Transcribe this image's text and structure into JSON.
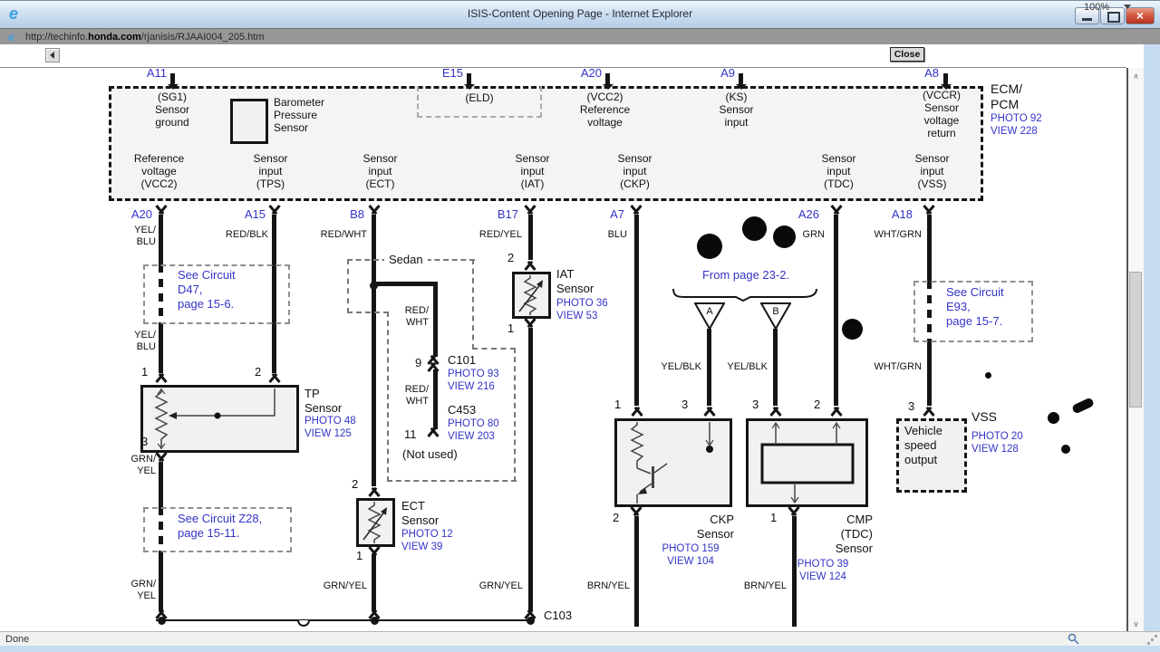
{
  "titlebar": {
    "title": "ISIS-Content Opening Page - Internet Explorer"
  },
  "addressbar": {
    "url_pre": "http://techinfo.",
    "url_domain": "honda.com",
    "url_path": "/rjanisis/RJAAI004_205.htm"
  },
  "toolbar": {
    "close": "Close"
  },
  "statusbar": {
    "status": "Done",
    "zoom": "100%"
  },
  "ecm": {
    "title": "ECM/\nPCM",
    "photo": "PHOTO 92",
    "view": "VIEW 228",
    "pins_top": [
      {
        "id": "A11",
        "label": "(SG1)\nSensor\nground"
      },
      {
        "id": "E15",
        "label": "(ELD)"
      },
      {
        "id": "A20",
        "label": "(VCC2)\nReference\nvoltage"
      },
      {
        "id": "A9",
        "label": "(KS)\nSensor\ninput"
      },
      {
        "id": "A8",
        "label": "(VCCR)\nSensor\nvoltage\nreturn"
      }
    ],
    "baro": "Barometer\nPressure\nSensor",
    "row": [
      "Reference\nvoltage\n(VCC2)",
      "Sensor\ninput\n(TPS)",
      "Sensor\ninput\n(ECT)",
      "Sensor\ninput\n(IAT)",
      "Sensor\ninput\n(CKP)",
      "Sensor\ninput\n(TDC)",
      "Sensor\ninput\n(VSS)"
    ],
    "pins_bottom": [
      "A20",
      "A15",
      "B8",
      "B17",
      "A7",
      "A26",
      "A18"
    ]
  },
  "wires": {
    "yel_blu_1": "YEL/\nBLU",
    "red_blk": "RED/BLK",
    "red_wht": "RED/WHT",
    "red_yel": "RED/YEL",
    "blu": "BLU",
    "grn": "GRN",
    "wht_grn_1": "WHT/GRN",
    "yel_blu_2": "YEL/\nBLU",
    "grn_yel_1": "GRN/\nYEL",
    "grn_yel_2": "GRN/\nYEL",
    "red_wht_b1": "RED/\nWHT",
    "red_wht_b2": "RED/\nWHT",
    "grn_yel_ect": "GRN/YEL",
    "grn_yel_iat": "GRN/YEL",
    "brn_yel_ckp": "BRN/YEL",
    "brn_yel_cmp": "BRN/YEL",
    "yel_blk_a": "YEL/BLK",
    "yel_blk_b": "YEL/BLK",
    "wht_grn_2": "WHT/GRN"
  },
  "notes": {
    "d47": "See Circuit\nD47,\npage 15-6.",
    "z28": "See Circuit Z28,\npage 15-11.",
    "e93": "See Circuit\nE93,\npage 15-7.",
    "from_page": "From page 23-2.",
    "sedan": "Sedan",
    "not_used": "(Not used)",
    "tri_a": "A",
    "tri_b": "B"
  },
  "connectors": {
    "c101": "C101",
    "c101_photo": "PHOTO 93",
    "c101_view": "VIEW 216",
    "c101_pin": "9",
    "c453": "C453",
    "c453_photo": "PHOTO 80",
    "c453_view": "VIEW 203",
    "c453_pin": "11",
    "c103": "C103"
  },
  "sensors": {
    "tp": {
      "name": "TP\nSensor",
      "photo": "PHOTO 48",
      "view": "VIEW 125",
      "p1": "1",
      "p2": "2",
      "p3": "3"
    },
    "iat": {
      "name": "IAT\nSensor",
      "photo": "PHOTO 36",
      "view": "VIEW 53",
      "p1": "1",
      "p2": "2"
    },
    "ect": {
      "name": "ECT\nSensor",
      "photo": "PHOTO 12",
      "view": "VIEW 39",
      "p1": "1",
      "p2": "2"
    },
    "ckp": {
      "name": "CKP\nSensor",
      "photo": "PHOTO 159",
      "view": "VIEW 104",
      "p1": "1",
      "p2": "2",
      "p3": "3"
    },
    "cmp": {
      "name": "CMP\n(TDC)\nSensor",
      "photo": "PHOTO 39",
      "view": "VIEW 124",
      "p1": "1",
      "p2": "2",
      "p3": "3"
    },
    "vss": {
      "name": "VSS",
      "photo": "PHOTO 20",
      "view": "VIEW 128",
      "label": "Vehicle\nspeed\noutput",
      "p3": "3"
    }
  }
}
